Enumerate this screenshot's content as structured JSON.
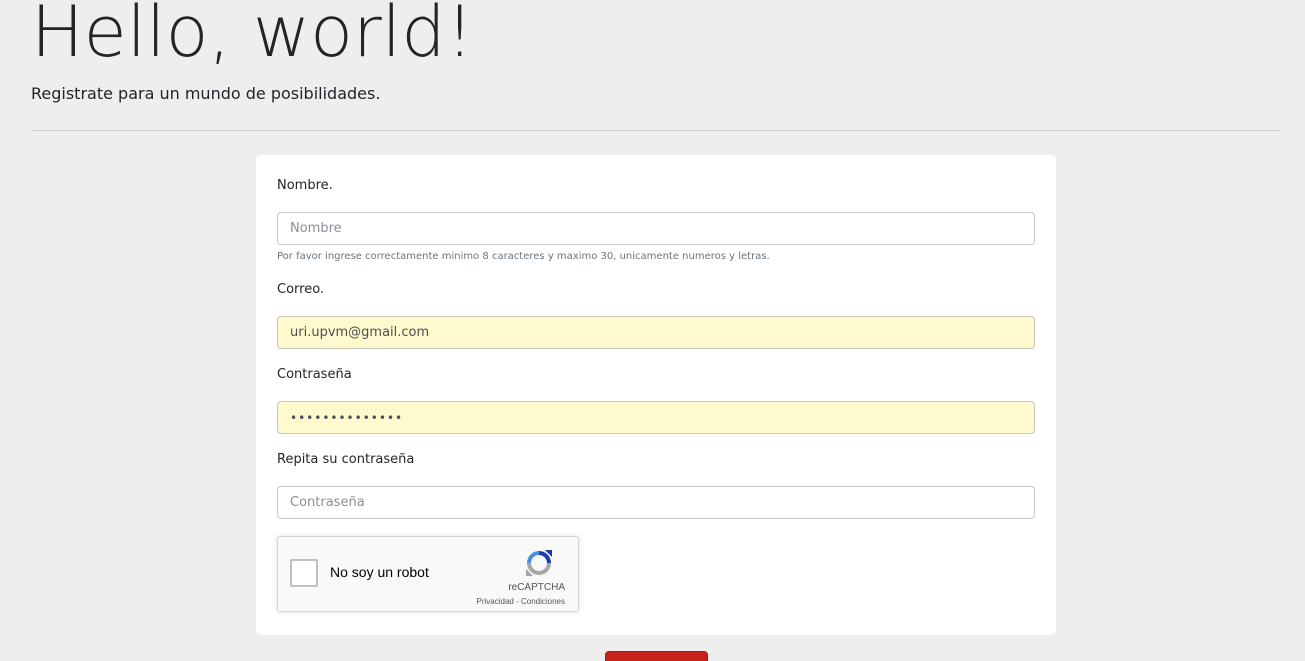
{
  "hero": {
    "title": "Hello, world!",
    "subtitle": "Registrate para un mundo de posibilidades."
  },
  "form": {
    "nombre": {
      "label": "Nombre.",
      "placeholder": "Nombre",
      "value": "",
      "help": "Por favor ingrese correctamente minimo 8 caracteres y maximo 30, unicamente numeros y letras."
    },
    "correo": {
      "label": "Correo.",
      "placeholder": "",
      "value": "uri.upvm@gmail.com"
    },
    "password": {
      "label": "Contraseña",
      "value": "••••••••••••••"
    },
    "password_repeat": {
      "label": "Repita su contraseña",
      "placeholder": "Contraseña",
      "value": ""
    },
    "recaptcha": {
      "label": "No soy un robot",
      "brand": "reCAPTCHA",
      "privacy": "Privacidad",
      "separator": " - ",
      "terms": "Condiciones",
      "logo_icon": "recaptcha-logo-icon"
    },
    "submit": {
      "label": ""
    }
  },
  "colors": {
    "page_background": "#eeeeee",
    "card_background": "#ffffff",
    "autofill_background": "#fffacd",
    "submit_button": "#c6221a",
    "text": "#212529"
  }
}
